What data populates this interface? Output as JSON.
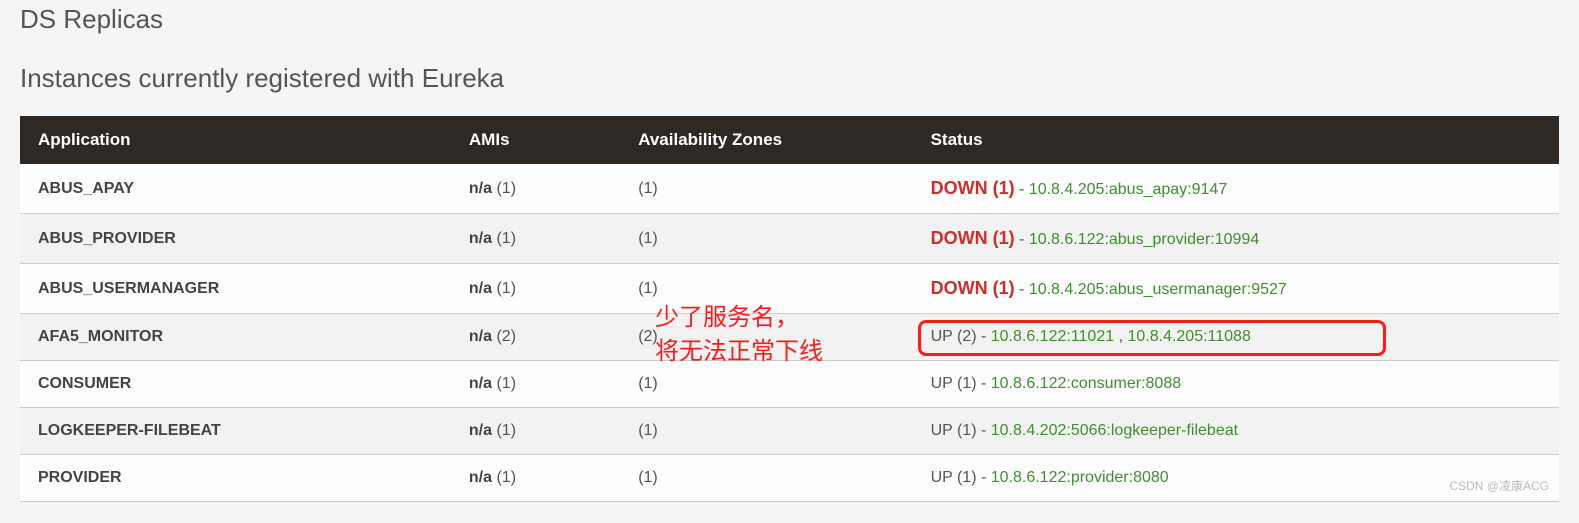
{
  "headers": {
    "ds_replicas": "DS Replicas",
    "instances": "Instances currently registered with Eureka"
  },
  "table": {
    "columns": {
      "application": "Application",
      "amis": "AMIs",
      "zones": "Availability Zones",
      "status": "Status"
    },
    "rows": [
      {
        "app": "ABUS_APAY",
        "amis_prefix": "n/a",
        "amis_count": " (1)",
        "zones": "(1)",
        "status_type": "DOWN",
        "status_label": "DOWN (1)",
        "dash": " - ",
        "instances": [
          {
            "text": "10.8.4.205:abus_apay:9147"
          }
        ]
      },
      {
        "app": "ABUS_PROVIDER",
        "amis_prefix": "n/a",
        "amis_count": " (1)",
        "zones": "(1)",
        "status_type": "DOWN",
        "status_label": "DOWN (1)",
        "dash": " - ",
        "instances": [
          {
            "text": "10.8.6.122:abus_provider:10994"
          }
        ]
      },
      {
        "app": "ABUS_USERMANAGER",
        "amis_prefix": "n/a",
        "amis_count": " (1)",
        "zones": "(1)",
        "status_type": "DOWN",
        "status_label": "DOWN (1)",
        "dash": " - ",
        "instances": [
          {
            "text": "10.8.4.205:abus_usermanager:9527"
          }
        ]
      },
      {
        "app": "AFA5_MONITOR",
        "amis_prefix": "n/a",
        "amis_count": " (2)",
        "zones": "(2)",
        "status_type": "UP",
        "status_label": "UP (2)",
        "dash": " - ",
        "instances": [
          {
            "text": "10.8.6.122:11021"
          },
          {
            "text": "10.8.4.205:11088"
          }
        ]
      },
      {
        "app": "CONSUMER",
        "amis_prefix": "n/a",
        "amis_count": " (1)",
        "zones": "(1)",
        "status_type": "UP",
        "status_label": "UP (1)",
        "dash": " - ",
        "instances": [
          {
            "text": "10.8.6.122:consumer:8088"
          }
        ]
      },
      {
        "app": "LOGKEEPER-FILEBEAT",
        "amis_prefix": "n/a",
        "amis_count": " (1)",
        "zones": "(1)",
        "status_type": "UP",
        "status_label": "UP (1)",
        "dash": " - ",
        "instances": [
          {
            "text": "10.8.4.202:5066:logkeeper-filebeat"
          }
        ]
      },
      {
        "app": "PROVIDER",
        "amis_prefix": "n/a",
        "amis_count": " (1)",
        "zones": "(1)",
        "status_type": "UP",
        "status_label": "UP (1)",
        "dash": " - ",
        "instances": [
          {
            "text": "10.8.6.122:provider:8080"
          }
        ]
      }
    ]
  },
  "annotation": {
    "line1": "少了服务名，",
    "line2": "将无法正常下线"
  },
  "watermark": "CSDN @凌康ACG",
  "instance_separator": " , "
}
